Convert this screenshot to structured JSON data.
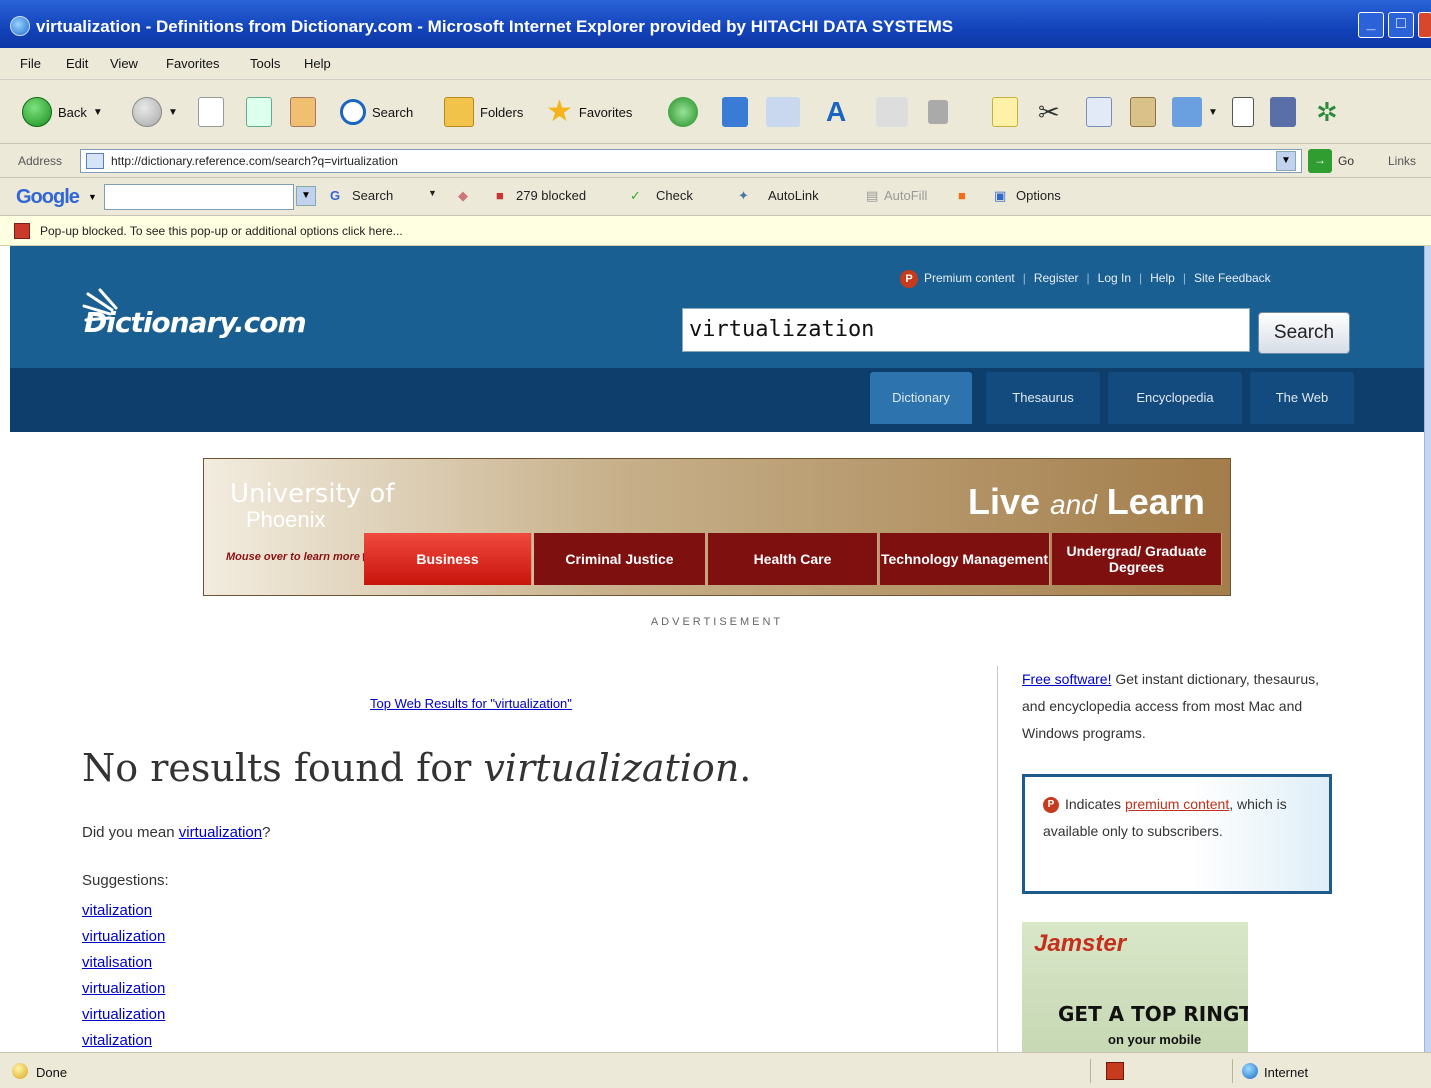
{
  "window": {
    "title": "virtualization - Definitions from Dictionary.com - Microsoft Internet Explorer provided by HITACHI DATA SYSTEMS"
  },
  "menu": [
    "File",
    "Edit",
    "View",
    "Favorites",
    "Tools",
    "Help"
  ],
  "toolbar": {
    "back": "Back",
    "search": "Search",
    "folders": "Folders",
    "favorites": "Favorites"
  },
  "address": {
    "label": "Address",
    "url": "http://dictionary.reference.com/search?q=virtualization",
    "go": "Go",
    "links": "Links"
  },
  "google_bar": {
    "logo": "Google",
    "search": "Search",
    "blocked": "279 blocked",
    "check": "Check",
    "autolink": "AutoLink",
    "autofill": "AutoFill",
    "options": "Options"
  },
  "popup_bar": {
    "text": "Pop-up blocked. To see this pop-up or additional options click here..."
  },
  "site": {
    "logo": "Dictionary.com",
    "top_links": [
      "Premium content",
      "Register",
      "Log In",
      "Help",
      "Site Feedback"
    ],
    "search_value": "virtualization",
    "search_button": "Search",
    "tabs": [
      "Dictionary",
      "Thesaurus",
      "Encyclopedia",
      "The Web"
    ],
    "active_tab": "Dictionary"
  },
  "banner": {
    "brand_line1": "University of",
    "brand_line2": "Phoenix",
    "tagline_a": "Live",
    "tagline_b": "and",
    "tagline_c": "Learn",
    "mouse_over": "Mouse over to learn more",
    "tabs": [
      "Business",
      "Criminal Justice",
      "Health Care",
      "Technology Management",
      "Undergrad/ Graduate Degrees"
    ],
    "advertisement": "ADVERTISEMENT"
  },
  "results": {
    "top_web": "Top Web Results for \"virtualization\"",
    "no_results_prefix": "No results found for",
    "no_results_term": "virtualization",
    "no_results_suffix": ".",
    "did_you_mean_prefix": "Did you mean",
    "did_you_mean_term": "virtualization",
    "did_you_mean_suffix": "?",
    "suggestions_heading": "Suggestions:",
    "suggestions": [
      "vitalization",
      "virtualization",
      "vitalisation",
      "virtualization",
      "virtualization",
      "vitalization"
    ]
  },
  "sidebar": {
    "promo_link": "Free software!",
    "promo_text": "Get instant dictionary, thesaurus, and encyclopedia access from most Mac and Windows programs.",
    "premium_prefix": "Indicates",
    "premium_link": "premium content",
    "premium_suffix": ", which is available only to subscribers.",
    "ad_brand": "Jamster",
    "ad_headline": "GET A TOP RINGTONE",
    "ad_sub": "on your mobile"
  },
  "status": {
    "left": "Done",
    "zone": "Internet"
  }
}
